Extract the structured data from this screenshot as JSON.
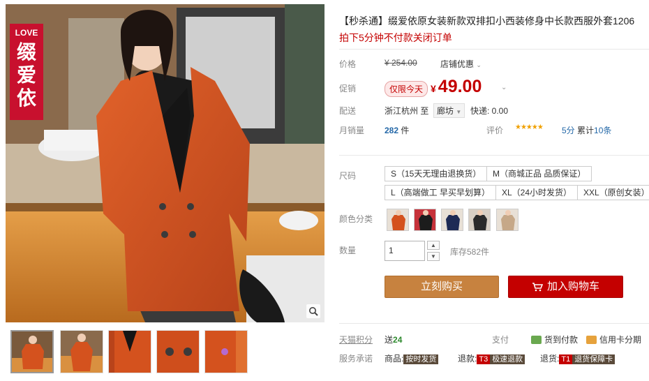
{
  "product": {
    "title": "【秒杀通】缀爱依原女装新款双排扣小西装修身中长款西服外套1206",
    "subtitle": "拍下5分钟不付款关闭订单"
  },
  "labels": {
    "price": "价格",
    "promo_price": "促销",
    "shipping": "配送",
    "monthly_sales": "月销量",
    "size": "尺码",
    "color": "颜色分类",
    "quantity": "数量",
    "tmall_points": "天猫积分",
    "service_promise": "服务承诺",
    "review": "评价",
    "payment": "支付"
  },
  "price": {
    "original": "¥ 254.00",
    "store_promo": "店铺优惠",
    "today_tag": "仅限今天",
    "currency": "¥",
    "current": "49.00"
  },
  "shipping": {
    "from": "浙江杭州 至",
    "to": "廊坊",
    "fee": "快递: 0.00"
  },
  "sales": {
    "count": "282",
    "unit": "件",
    "rating_stars": "★★★★★",
    "score": "5分",
    "reviews_prefix": "累计",
    "reviews_count": "10条"
  },
  "sizes": [
    "S（15天无理由退换货）",
    "M（商城正品 品质保证）",
    "L（高端做工 早买早划算）",
    "XL（24小时发货）",
    "XXL（原创女装）"
  ],
  "quantity": {
    "value": "1",
    "stock": "库存582件",
    "up": "▲",
    "down": "▼"
  },
  "buttons": {
    "buy_now": "立刻购买",
    "add_cart": "加入购物车"
  },
  "points": {
    "prefix": "送",
    "value": "24"
  },
  "payment": {
    "cod": "货到付款",
    "credit": "信用卡分期"
  },
  "promise": {
    "goods_prefix": "商品:",
    "goods_tag": "按时发货",
    "return_prefix": "退款:",
    "return_code": "T3",
    "return_tag": "极速退款",
    "refund_prefix": "退货:",
    "refund_code": "T1",
    "refund_tag": "退货保障卡"
  },
  "badge": {
    "love": "LOVE",
    "brand_line1": "缀",
    "brand_line2": "爱",
    "brand_line3": "依"
  },
  "colors": {
    "accent_red": "#c40000",
    "coat_orange": "#d4521e",
    "buy_orange": "#c7823f"
  }
}
